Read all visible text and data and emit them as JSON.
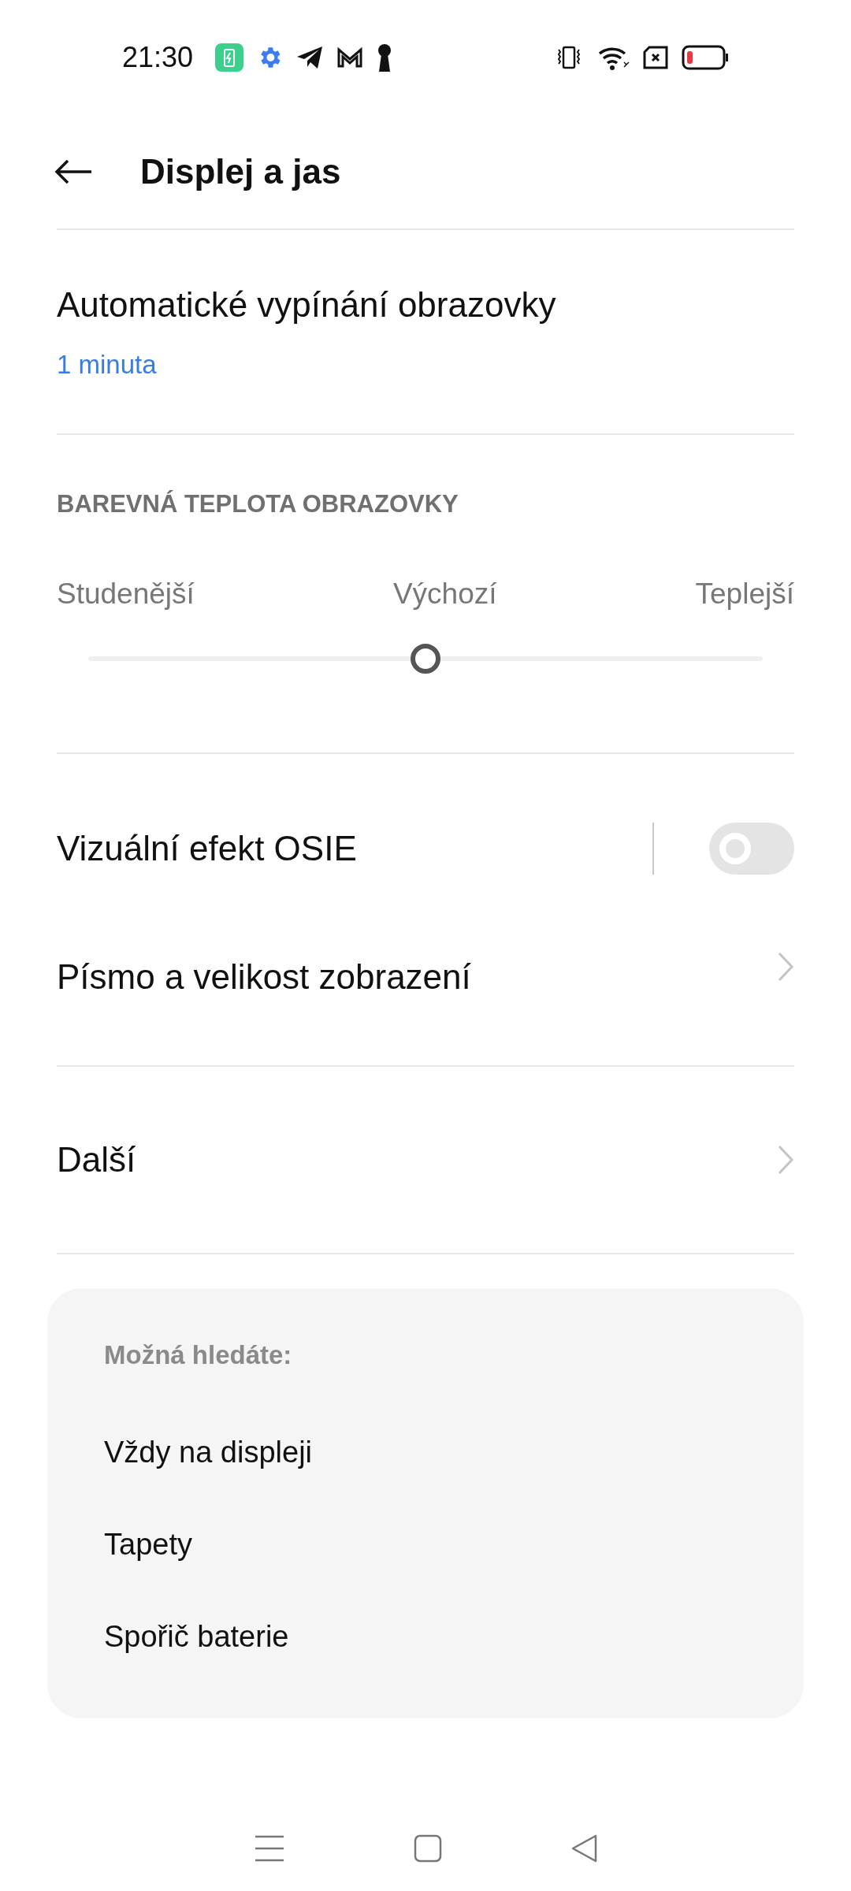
{
  "status_bar": {
    "time": "21:30"
  },
  "header": {
    "title": "Displej a jas"
  },
  "screen_timeout": {
    "title": "Automatické vypínání obrazovky",
    "value": "1 minuta"
  },
  "color_temperature": {
    "heading": "BAREVNÁ TEPLOTA OBRAZOVKY",
    "labels": [
      "Studenější",
      "Výchozí",
      "Teplejší"
    ],
    "level": 0.5
  },
  "settings": [
    {
      "kind": "toggle",
      "label": "Vizuální efekt OSIE",
      "on": false
    },
    {
      "kind": "link",
      "label": "Písmo a velikost zobrazení"
    },
    {
      "kind": "link",
      "label": "Další"
    }
  ],
  "suggestions": {
    "heading": "Možná hledáte:",
    "items": [
      "Vždy na displeji",
      "Tapety",
      "Spořič baterie"
    ]
  }
}
